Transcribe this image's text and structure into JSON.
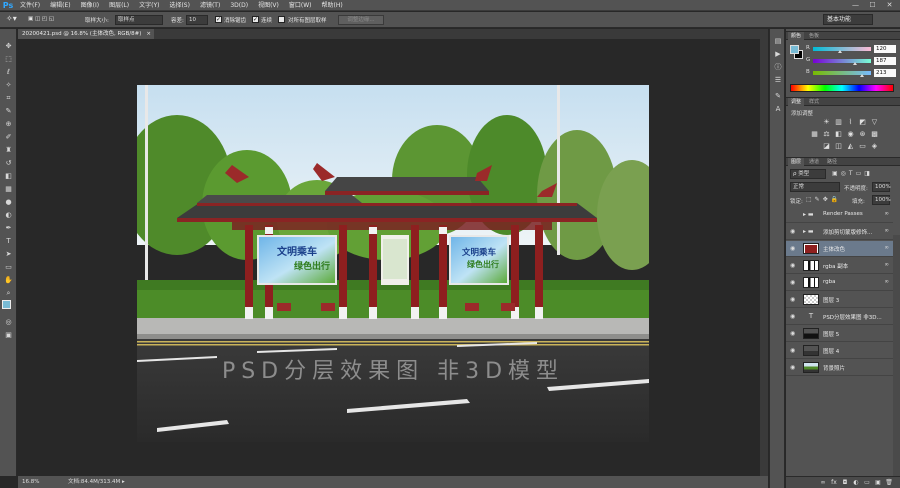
{
  "app": {
    "logo": "Ps"
  },
  "menu": [
    "文件(F)",
    "编辑(E)",
    "图像(I)",
    "图层(L)",
    "文字(Y)",
    "选择(S)",
    "滤镜(T)",
    "3D(D)",
    "视图(V)",
    "窗口(W)",
    "帮助(H)"
  ],
  "window_controls": {
    "minimize": "—",
    "maximize": "☐",
    "close": "✕"
  },
  "options": {
    "sample_size_label": "取样大小:",
    "sample_size_value": "取样点",
    "tolerance_label": "容差:",
    "tolerance_value": "10",
    "antialias_label": "消除锯齿",
    "contiguous_label": "连续",
    "sample_all_label": "对所有图层取样",
    "refine_edge_label": "调整边缘...",
    "workspace": "基本功能"
  },
  "document": {
    "tab_title": "20200421.psd @ 16.8% (主体改色, RGB/8#)",
    "close_icon": "×",
    "watermark": "PSD分层效果图   非3D模型",
    "zoom": "16.8%",
    "doc_size": "文档:84.4M/313.4M"
  },
  "color_panel": {
    "tabs": [
      "颜色",
      "色板"
    ],
    "channels": [
      {
        "label": "R",
        "value": "120",
        "fraction": 0.47
      },
      {
        "label": "G",
        "value": "187",
        "fraction": 0.73
      },
      {
        "label": "B",
        "value": "213",
        "fraction": 0.84
      }
    ],
    "foreground": "#78bbd5"
  },
  "adjustments_panel": {
    "tabs": [
      "调整",
      "样式"
    ],
    "title": "添加调整"
  },
  "layers_panel": {
    "tabs": [
      "图层",
      "通道",
      "路径"
    ],
    "filter_kind": "ρ 类型",
    "blend_mode": "正常",
    "opacity_label": "不透明度:",
    "opacity_value": "100%",
    "lock_label": "锁定:",
    "fill_label": "填充:",
    "fill_value": "100%",
    "layers": [
      {
        "name": "Render Passes",
        "kind": "group",
        "fx": "",
        "selected": false
      },
      {
        "name": "添加剪切蒙版修饰...",
        "kind": "group",
        "fx": "",
        "selected": false
      },
      {
        "name": "主体改色",
        "kind": "red",
        "fx": "",
        "selected": true
      },
      {
        "name": "rgba 副本",
        "kind": "mask",
        "fx": "",
        "selected": false
      },
      {
        "name": "rgba",
        "kind": "mask",
        "fx": "",
        "selected": false
      },
      {
        "name": "图层 3",
        "kind": "checker",
        "fx": "",
        "selected": false
      },
      {
        "name": "PSD分层效果图  非3D...",
        "kind": "text",
        "fx": "",
        "selected": false
      },
      {
        "name": "图层 5",
        "kind": "dark",
        "fx": "",
        "selected": false
      },
      {
        "name": "图层 4",
        "kind": "road",
        "fx": "",
        "selected": false
      },
      {
        "name": "背景照片",
        "kind": "photo",
        "fx": "",
        "selected": false
      }
    ]
  }
}
